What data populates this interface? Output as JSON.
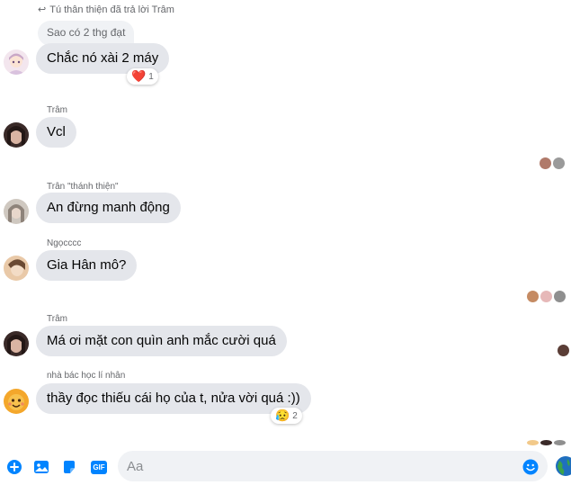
{
  "reply_header": "Tú thân thiện đã trả lời Trâm",
  "quoted_text": "Sao có 2 thg đạt",
  "messages": [
    {
      "sender": "",
      "text": "Chắc nó xài 2 máy",
      "reaction_emoji": "❤️",
      "reaction_count": "1"
    },
    {
      "sender": "Trâm",
      "text": "Vcl"
    },
    {
      "sender": "Trân \"thánh thiện\"",
      "text": "An đừng manh động"
    },
    {
      "sender": "Ngọcccc",
      "text": "Gia Hân mô?"
    },
    {
      "sender": "Trâm",
      "text": "Má ơi mặt con quìn anh mắc cười quá"
    },
    {
      "sender": "nhà bác học lí nhân",
      "text": "thầy đọc thiếu cái họ của t, nửa vời quá  :))",
      "reaction_emoji": "😥",
      "reaction_count": "2"
    }
  ],
  "composer": {
    "placeholder": "Aa",
    "icons": [
      "plus-icon",
      "image-icon",
      "sticker-icon",
      "gif-icon",
      "emoji-icon",
      "globe-icon"
    ],
    "gif_label": "GIF"
  },
  "colors": {
    "accent": "#0084ff",
    "bubble": "#e4e6eb",
    "secondary_text": "#65676b"
  }
}
